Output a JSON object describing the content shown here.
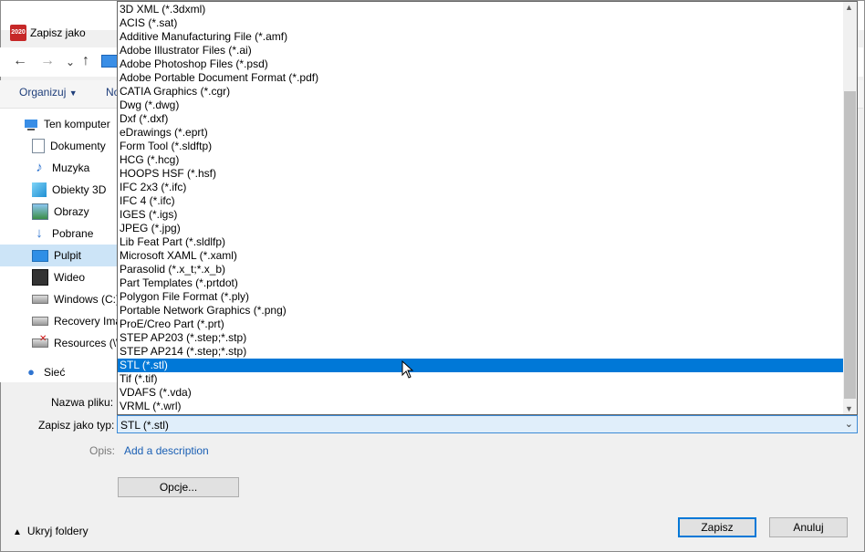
{
  "window": {
    "title": "Zapisz jako",
    "app_badge": "2020"
  },
  "toolbar": {
    "organize": "Organizuj",
    "new_partial": "No"
  },
  "nav": {
    "back": "←",
    "forward": "→",
    "history": "⌄",
    "up": "↑"
  },
  "tree": {
    "items": [
      {
        "label": "Ten komputer",
        "icon": "computer-icon"
      },
      {
        "label": "Dokumenty",
        "icon": "documents-icon"
      },
      {
        "label": "Muzyka",
        "icon": "music-icon"
      },
      {
        "label": "Obiekty 3D",
        "icon": "objects-3d-icon"
      },
      {
        "label": "Obrazy",
        "icon": "pictures-icon"
      },
      {
        "label": "Pobrane",
        "icon": "downloads-icon"
      },
      {
        "label": "Pulpit",
        "icon": "desktop-icon",
        "selected": true
      },
      {
        "label": "Wideo",
        "icon": "video-icon"
      },
      {
        "label": "Windows (C:)",
        "icon": "drive-icon"
      },
      {
        "label": "Recovery Ima",
        "icon": "drive-icon"
      },
      {
        "label": "Resources (\\\\",
        "icon": "network-drive-icon"
      },
      {
        "label": "Sieć",
        "icon": "network-icon"
      }
    ]
  },
  "form": {
    "filename_label": "Nazwa pliku:",
    "type_label": "Zapisz jako typ:",
    "type_value": "STL (*.stl)",
    "desc_label": "Opis:",
    "desc_link": "Add a description",
    "options_button": "Opcje...",
    "save_button": "Zapisz",
    "cancel_button": "Anuluj",
    "hide_folders": "Ukryj foldery"
  },
  "dropdown": {
    "selected_index": 26,
    "items": [
      "3D XML (*.3dxml)",
      "ACIS (*.sat)",
      "Additive Manufacturing File (*.amf)",
      "Adobe Illustrator Files (*.ai)",
      "Adobe Photoshop Files (*.psd)",
      "Adobe Portable Document Format (*.pdf)",
      "CATIA Graphics (*.cgr)",
      "Dwg (*.dwg)",
      "Dxf (*.dxf)",
      "eDrawings (*.eprt)",
      "Form Tool (*.sldftp)",
      "HCG (*.hcg)",
      "HOOPS HSF (*.hsf)",
      "IFC 2x3 (*.ifc)",
      "IFC 4 (*.ifc)",
      "IGES (*.igs)",
      "JPEG (*.jpg)",
      "Lib Feat Part (*.sldlfp)",
      "Microsoft XAML (*.xaml)",
      "Parasolid (*.x_t;*.x_b)",
      "Part Templates (*.prtdot)",
      "Polygon File Format (*.ply)",
      "Portable Network Graphics (*.png)",
      "ProE/Creo Part (*.prt)",
      "STEP AP203 (*.step;*.stp)",
      "STEP AP214 (*.step;*.stp)",
      "STL (*.stl)",
      "Tif (*.tif)",
      "VDAFS (*.vda)",
      "VRML (*.wrl)"
    ]
  }
}
